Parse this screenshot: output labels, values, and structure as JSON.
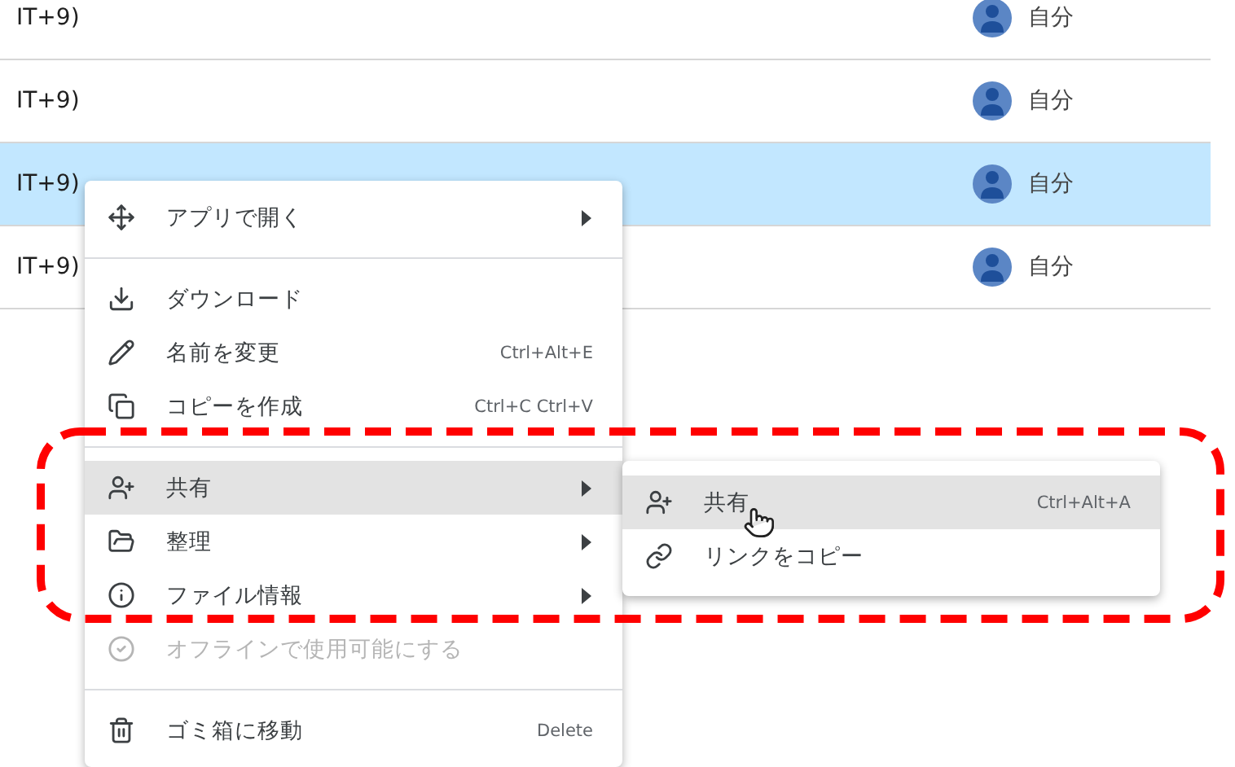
{
  "file_list": {
    "rows": [
      {
        "name": "IT+9)",
        "owner": "自分",
        "selected": false
      },
      {
        "name": "IT+9)",
        "owner": "自分",
        "selected": false
      },
      {
        "name": "IT+9)",
        "owner": "自分",
        "selected": true
      },
      {
        "name": "IT+9)",
        "owner": "自分",
        "selected": false
      }
    ]
  },
  "context_menu": {
    "items": [
      {
        "kind": "item",
        "label": "アプリで開く",
        "submenu": true,
        "selected": false,
        "disabled": false
      },
      {
        "kind": "divider"
      },
      {
        "kind": "item",
        "label": "ダウンロード",
        "submenu": false,
        "selected": false,
        "disabled": false
      },
      {
        "kind": "item",
        "label": "名前を変更",
        "shortcut": "Ctrl+Alt+E",
        "submenu": false,
        "selected": false,
        "disabled": false
      },
      {
        "kind": "item",
        "label": "コピーを作成",
        "shortcut": "Ctrl+C Ctrl+V",
        "submenu": false,
        "selected": false,
        "disabled": false
      },
      {
        "kind": "divider"
      },
      {
        "kind": "item",
        "label": "共有",
        "submenu": true,
        "selected": true,
        "disabled": false
      },
      {
        "kind": "item",
        "label": "整理",
        "submenu": true,
        "selected": false,
        "disabled": false
      },
      {
        "kind": "item",
        "label": "ファイル情報",
        "submenu": true,
        "selected": false,
        "disabled": false
      },
      {
        "kind": "item",
        "label": "オフラインで使用可能にする",
        "submenu": false,
        "selected": false,
        "disabled": true
      },
      {
        "kind": "divider"
      },
      {
        "kind": "item",
        "label": "ゴミ箱に移動",
        "shortcut": "Delete",
        "submenu": false,
        "selected": false,
        "disabled": false
      }
    ]
  },
  "submenu": {
    "items": [
      {
        "label": "共有",
        "shortcut": "Ctrl+Alt+A",
        "selected": true
      },
      {
        "label": "リンクをコピー",
        "selected": false
      }
    ]
  }
}
